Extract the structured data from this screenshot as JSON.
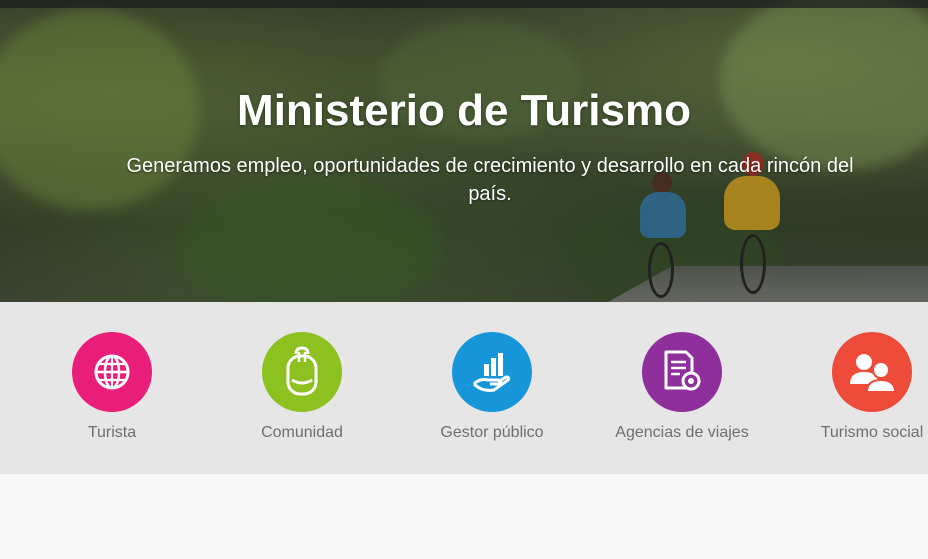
{
  "hero": {
    "title": "Ministerio de Turismo",
    "subtitle": "Generamos empleo, oportunidades de crecimiento y desarrollo en cada rincón del país."
  },
  "categories": [
    {
      "label": "Turista",
      "color": "#e91e7a",
      "icon": "globe-icon"
    },
    {
      "label": "Comunidad",
      "color": "#8cc11f",
      "icon": "backpack-icon"
    },
    {
      "label": "Gestor público",
      "color": "#1796d9",
      "icon": "hand-chart-icon"
    },
    {
      "label": "Agencias de viajes",
      "color": "#8e2f9c",
      "icon": "certificate-icon"
    },
    {
      "label": "Turismo social",
      "color": "#ee4b3a",
      "icon": "people-icon"
    }
  ]
}
